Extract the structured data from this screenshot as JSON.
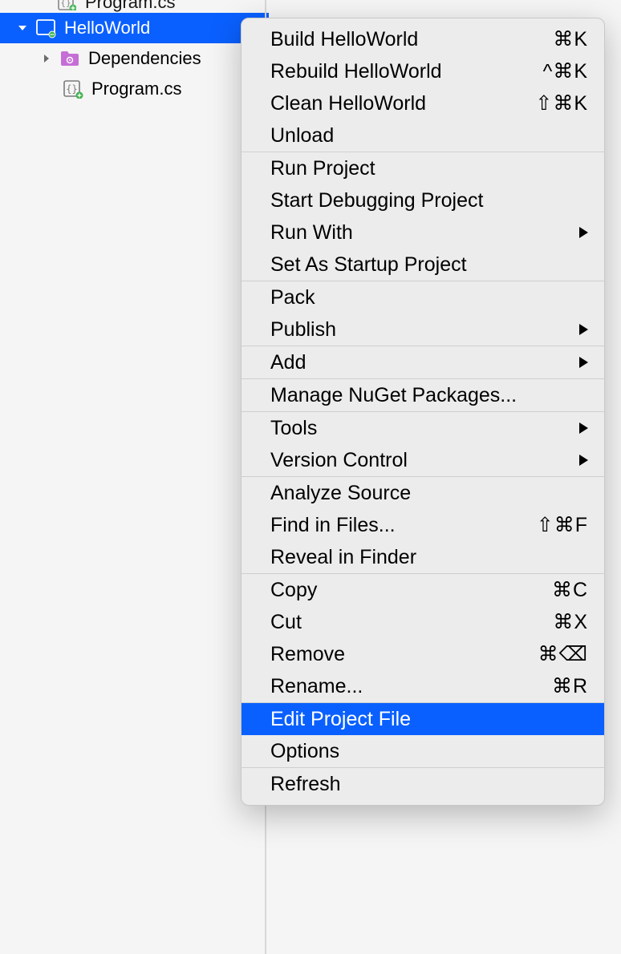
{
  "tree": {
    "cutoff_label": "Program.cs",
    "project_label": "HelloWorld",
    "dependencies_label": "Dependencies",
    "program_label": "Program.cs"
  },
  "menu": {
    "group1": [
      {
        "label": "Build HelloWorld",
        "shortcut": "⌘K"
      },
      {
        "label": "Rebuild HelloWorld",
        "shortcut": "^⌘K"
      },
      {
        "label": "Clean HelloWorld",
        "shortcut": "⇧⌘K"
      },
      {
        "label": "Unload",
        "shortcut": ""
      }
    ],
    "group2": [
      {
        "label": "Run Project",
        "shortcut": ""
      },
      {
        "label": "Start Debugging Project",
        "shortcut": ""
      },
      {
        "label": "Run With",
        "shortcut": "",
        "submenu": true
      },
      {
        "label": "Set As Startup Project",
        "shortcut": ""
      }
    ],
    "group3": [
      {
        "label": "Pack",
        "shortcut": ""
      },
      {
        "label": "Publish",
        "shortcut": "",
        "submenu": true
      }
    ],
    "group4": [
      {
        "label": "Add",
        "shortcut": "",
        "submenu": true
      }
    ],
    "group5": [
      {
        "label": "Manage NuGet Packages...",
        "shortcut": ""
      }
    ],
    "group6": [
      {
        "label": "Tools",
        "shortcut": "",
        "submenu": true
      },
      {
        "label": "Version Control",
        "shortcut": "",
        "submenu": true
      }
    ],
    "group7": [
      {
        "label": "Analyze Source",
        "shortcut": ""
      },
      {
        "label": "Find in Files...",
        "shortcut": "⇧⌘F"
      },
      {
        "label": "Reveal in Finder",
        "shortcut": ""
      }
    ],
    "group8": [
      {
        "label": "Copy",
        "shortcut": "⌘C"
      },
      {
        "label": "Cut",
        "shortcut": "⌘X"
      },
      {
        "label": "Remove",
        "shortcut": "⌘⌫"
      },
      {
        "label": "Rename...",
        "shortcut": "⌘R"
      }
    ],
    "group9": [
      {
        "label": "Edit Project File",
        "shortcut": "",
        "highlight": true
      },
      {
        "label": "Options",
        "shortcut": ""
      }
    ],
    "group10": [
      {
        "label": "Refresh",
        "shortcut": ""
      }
    ]
  }
}
